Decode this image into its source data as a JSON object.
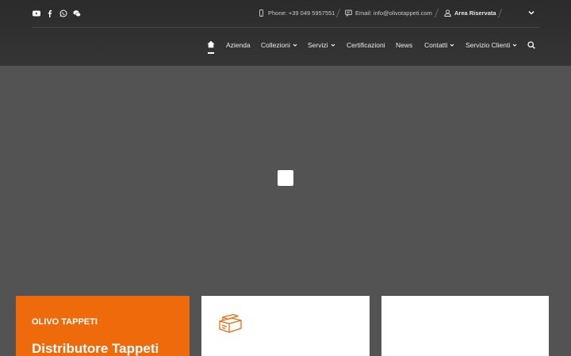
{
  "colors": {
    "accent": "#ee6a0b",
    "header_bg": "#2b2b2b",
    "page_bg": "#535353"
  },
  "social_icons": [
    "youtube-icon",
    "facebook-icon",
    "whatsapp-icon",
    "wechat-icon"
  ],
  "topbar": {
    "phone": "Phone: +39 049 5957551",
    "email": "Email: info@olivotappeti.com",
    "reserved_area": "Area Riservata"
  },
  "nav": {
    "items": [
      {
        "label": "Azienda"
      },
      {
        "label": "Collezioni"
      },
      {
        "label": "Servizi"
      },
      {
        "label": "Certificazioni"
      },
      {
        "label": "News"
      },
      {
        "label": "Contatti"
      },
      {
        "label": "Servizio Clienti"
      }
    ]
  },
  "cards": {
    "orange": {
      "kicker": "OLIVO TAPPETI",
      "title": "Distributore Tappeti"
    }
  }
}
